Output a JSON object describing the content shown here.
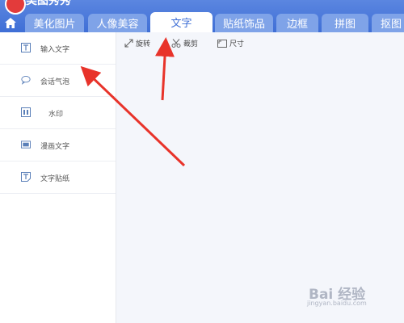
{
  "header": {
    "app_title": "美图秀秀",
    "tabs": [
      {
        "label": "美化图片"
      },
      {
        "label": "人像美容"
      },
      {
        "label": "文字"
      },
      {
        "label": "贴纸饰品"
      },
      {
        "label": "边框"
      },
      {
        "label": "拼图"
      },
      {
        "label": "抠图"
      }
    ],
    "active_tab": "文字"
  },
  "sidebar": {
    "items": [
      {
        "label": "输入文字",
        "icon": "text-input-icon"
      },
      {
        "label": "会话气泡",
        "icon": "speech-bubble-icon"
      },
      {
        "label": "水印",
        "icon": "watermark-icon"
      },
      {
        "label": "漫画文字",
        "icon": "comic-text-icon"
      },
      {
        "label": "文字贴纸",
        "icon": "text-sticker-icon"
      }
    ]
  },
  "toolbar": {
    "rotate_label": "旋转",
    "crop_label": "裁剪",
    "size_label": "尺寸"
  },
  "watermark": {
    "logo_text": "Bai 经验",
    "url_text": "jingyan.baidu.com"
  },
  "colors": {
    "header_blue": "#3f6fd6",
    "annotation_red": "#e8332a"
  }
}
